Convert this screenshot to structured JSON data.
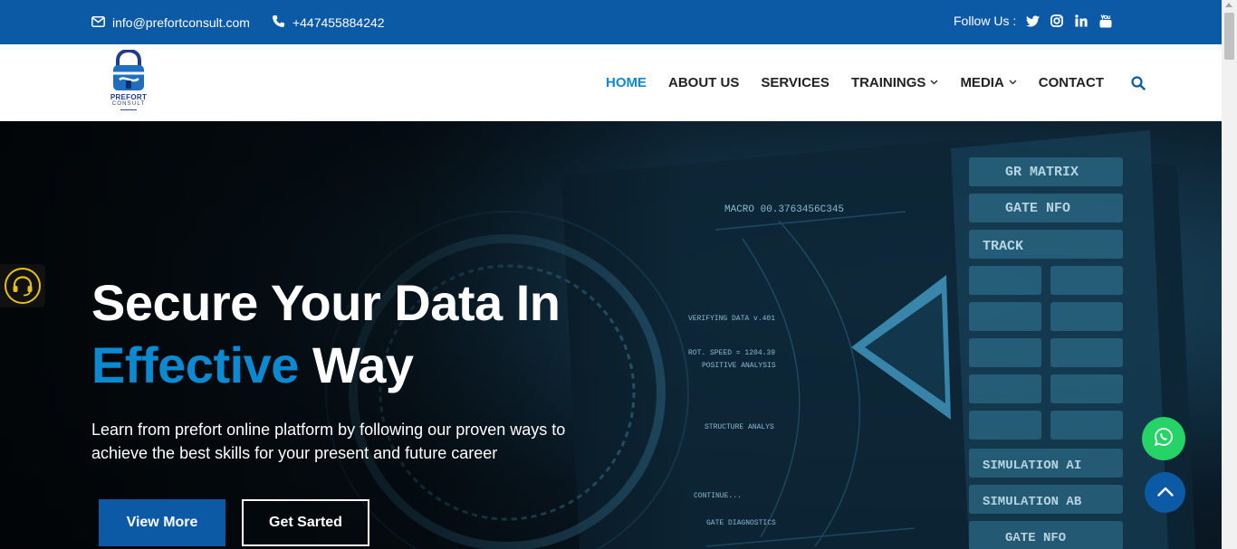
{
  "topbar": {
    "email": "info@prefortconsult.com",
    "phone": "+447455884242",
    "follow_label": "Follow Us :",
    "social": [
      "twitter-icon",
      "instagram-icon",
      "linkedin-icon",
      "youtube-icon"
    ]
  },
  "logo": {
    "brand": "PREFORT",
    "sub": "CONSULT"
  },
  "nav": {
    "items": [
      {
        "label": "HOME",
        "active": true
      },
      {
        "label": "ABOUT US"
      },
      {
        "label": "SERVICES"
      },
      {
        "label": "TRAININGS",
        "dropdown": true
      },
      {
        "label": "MEDIA",
        "dropdown": true
      },
      {
        "label": "CONTACT"
      }
    ]
  },
  "hero": {
    "title_line1": "Secure Your Data In",
    "title_accent": "Effective",
    "title_rest": " Way",
    "lead": "Learn from prefort online platform by following our proven ways to achieve the best skills for your present and future career",
    "primary_button": "View More",
    "secondary_button": "Get Sarted",
    "screen_text": [
      "MACRO 00.3763456C345",
      "GR MATRIX",
      "GATE NFO",
      "TRACK",
      "SIMULATION AI",
      "SIMULATION AB",
      "GATE NFO",
      "VERIFYING DATA v.401",
      "ROT. SPEED = 1204.39",
      "POSITIVE ANALYSIS",
      "STRUCTURE ANALYS",
      "CONTINUE...",
      "GATE DIAGNOSTICS"
    ]
  },
  "colors": {
    "brand_blue": "#0c5aa6",
    "accent_blue": "#0c8ad1",
    "whatsapp_green": "#25d366",
    "support_yellow": "#e7c01a"
  }
}
